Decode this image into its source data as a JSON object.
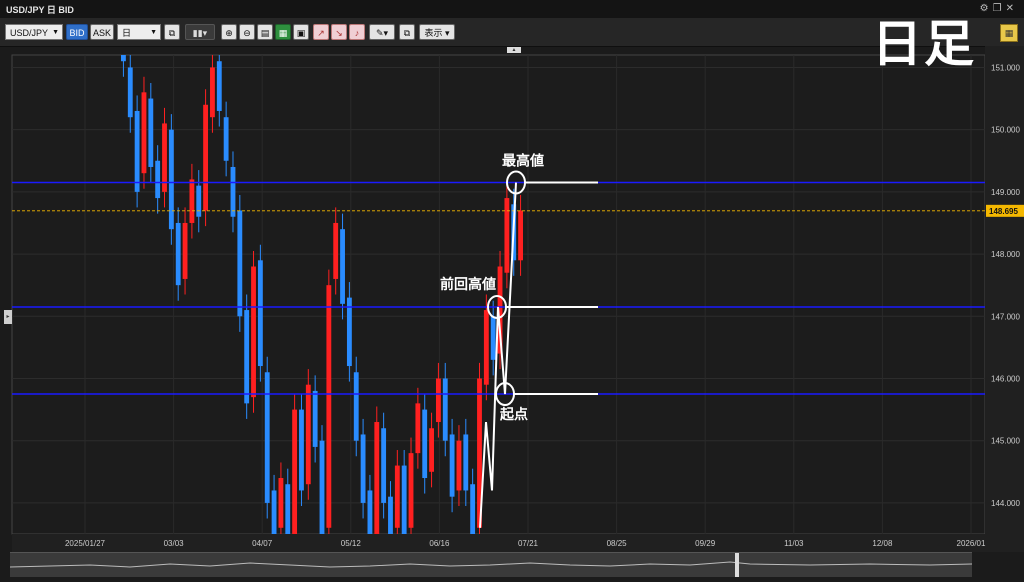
{
  "window": {
    "title": "USD/JPY 日 BID"
  },
  "toolbar": {
    "pair": "USD/JPY",
    "bid_label": "BID",
    "ask_label": "ASK",
    "timeframe": "日",
    "display_label": "表示"
  },
  "overlay_label": "日足",
  "chart_data": {
    "type": "candlestick",
    "y_range": [
      143.5,
      151.2
    ],
    "y_ticks": [
      "151.000",
      "150.000",
      "149.000",
      "148.000",
      "147.000",
      "146.000",
      "145.000",
      "144.000"
    ],
    "y_tick_values": [
      151,
      150,
      149,
      148,
      147,
      146,
      145,
      144
    ],
    "x_ticks": [
      "2025/01/27",
      "03/03",
      "04/07",
      "05/12",
      "06/16",
      "07/21",
      "08/25",
      "09/29",
      "11/03",
      "12/08",
      "2026/01"
    ],
    "current_price_label": "148.695",
    "current_price": 148.695,
    "horizontal_lines": [
      149.15,
      147.15,
      145.75
    ],
    "annotations": [
      "最高値",
      "前回高値",
      "起点"
    ],
    "colors": {
      "up": "#ff2020",
      "down": "#2a8cff",
      "line": "#1a1aff",
      "current": "#f5b800",
      "annotation": "#ffffff"
    },
    "grid": true
  }
}
